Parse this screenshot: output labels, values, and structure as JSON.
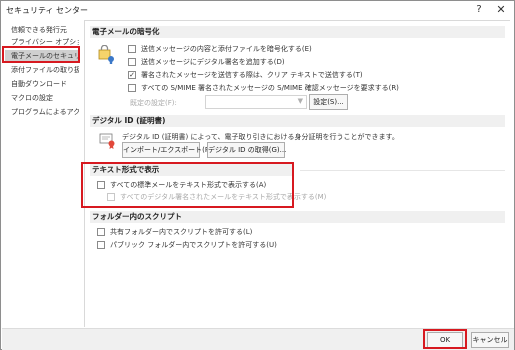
{
  "window": {
    "title": "セキュリティ センター",
    "help_glyph": "?",
    "close_glyph": "✕"
  },
  "sidebar": {
    "items": [
      {
        "label": "信頼できる発行元"
      },
      {
        "label": "プライバシー オプション"
      },
      {
        "label": "電子メールのセキュリティ"
      },
      {
        "label": "添付ファイルの取り扱い"
      },
      {
        "label": "自動ダウンロード"
      },
      {
        "label": "マクロの設定"
      },
      {
        "label": "プログラムによるアクセス"
      }
    ],
    "selected_index": 2
  },
  "encrypted_email": {
    "heading": "電子メールの暗号化",
    "icon": "lock-key-icon",
    "options": [
      {
        "label": "送信メッセージの内容と添付ファイルを暗号化する(E)",
        "checked": false,
        "enabled": true
      },
      {
        "label": "送信メッセージにデジタル署名を追加する(D)",
        "checked": false,
        "enabled": true
      },
      {
        "label": "署名されたメッセージを送信する際は、クリア テキストで送信する(T)",
        "checked": true,
        "enabled": true
      },
      {
        "label": "すべての S/MIME 署名されたメッセージの S/MIME 確認メッセージを要求する(R)",
        "checked": false,
        "enabled": true
      }
    ],
    "default_setting_label": "既定の設定(F):",
    "settings_button": "設定(S)..."
  },
  "digital_id": {
    "heading": "デジタル ID (証明書)",
    "icon": "certificate-icon",
    "description": "デジタル ID (証明書) によって、電子取り引きにおける身分証明を行うことができます。",
    "import_export_button": "インポート/エクスポート(P)...",
    "get_id_button": "デジタル ID の取得(G)..."
  },
  "plain_text": {
    "heading": "テキスト形式で表示",
    "options": [
      {
        "label": "すべての標準メールをテキスト形式で表示する(A)",
        "checked": false,
        "enabled": true
      },
      {
        "label": "すべてのデジタル署名されたメールをテキスト形式で表示する(M)",
        "checked": false,
        "enabled": false
      }
    ]
  },
  "folder_script": {
    "heading": "フォルダー内のスクリプト",
    "options": [
      {
        "label": "共有フォルダー内でスクリプトを許可する(L)",
        "checked": false,
        "enabled": true
      },
      {
        "label": "パブリック フォルダー内でスクリプトを許可する(U)",
        "checked": false,
        "enabled": true
      }
    ]
  },
  "footer": {
    "ok_button": "OK",
    "cancel_button": "キャンセル"
  },
  "colors": {
    "highlight": "#d71920",
    "selected_bg": "#cfcfcf",
    "section_bg": "#f0f0f0"
  }
}
